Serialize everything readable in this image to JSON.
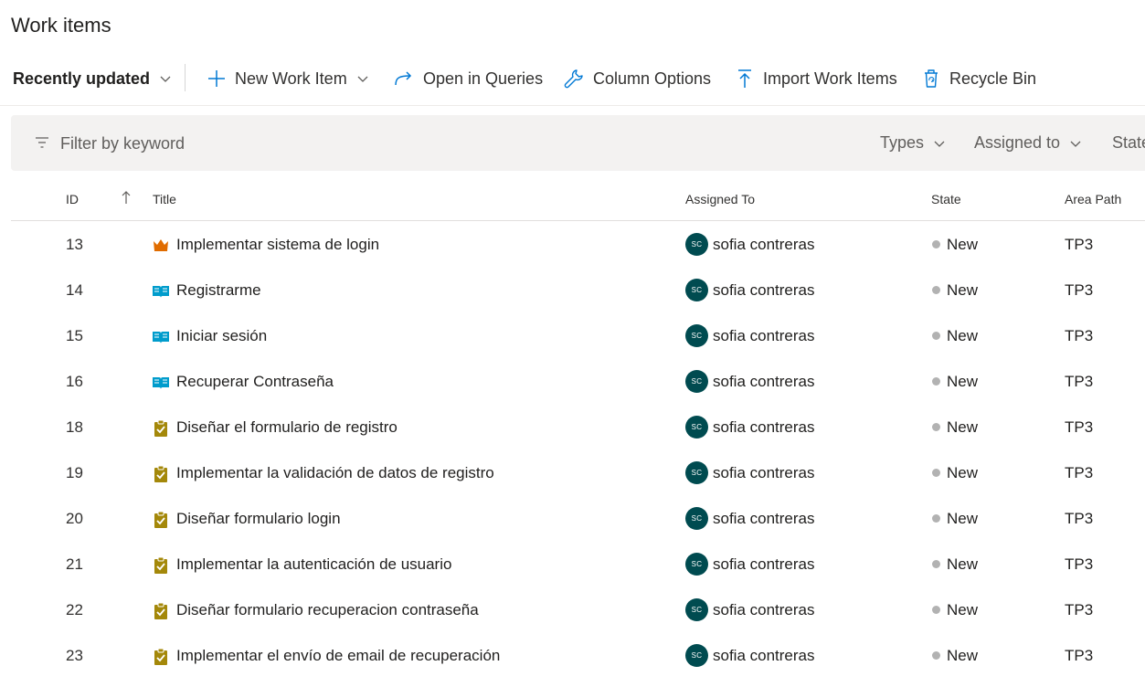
{
  "page": {
    "title": "Work items"
  },
  "toolbar": {
    "view_label": "Recently updated",
    "new_label": "New Work Item",
    "queries_label": "Open in Queries",
    "columns_label": "Column Options",
    "import_label": "Import Work Items",
    "recycle_label": "Recycle Bin"
  },
  "filter": {
    "placeholder": "Filter by keyword",
    "types_label": "Types",
    "assigned_label": "Assigned to",
    "state_label": "State"
  },
  "columns": {
    "id": "ID",
    "title": "Title",
    "assigned_to": "Assigned To",
    "state": "State",
    "area_path": "Area Path"
  },
  "colors": {
    "epic": "#e06c00",
    "user_story": "#009ccc",
    "task": "#a4880a",
    "avatar": "#004b50",
    "state_new": "#b2b2b2"
  },
  "rows": [
    {
      "id": "13",
      "type": "epic-icon",
      "title": "Implementar sistema de login",
      "initials": "SC",
      "assigned": "sofia contreras",
      "state": "New",
      "area": "TP3"
    },
    {
      "id": "14",
      "type": "user-story-icon",
      "title": "Registrarme",
      "initials": "SC",
      "assigned": "sofia contreras",
      "state": "New",
      "area": "TP3"
    },
    {
      "id": "15",
      "type": "user-story-icon",
      "title": "Iniciar sesión",
      "initials": "SC",
      "assigned": "sofia contreras",
      "state": "New",
      "area": "TP3"
    },
    {
      "id": "16",
      "type": "user-story-icon",
      "title": "Recuperar Contraseña",
      "initials": "SC",
      "assigned": "sofia contreras",
      "state": "New",
      "area": "TP3"
    },
    {
      "id": "18",
      "type": "task-icon",
      "title": "Diseñar el formulario de registro",
      "initials": "SC",
      "assigned": "sofia contreras",
      "state": "New",
      "area": "TP3"
    },
    {
      "id": "19",
      "type": "task-icon",
      "title": "Implementar la validación de datos de registro",
      "initials": "SC",
      "assigned": "sofia contreras",
      "state": "New",
      "area": "TP3"
    },
    {
      "id": "20",
      "type": "task-icon",
      "title": "Diseñar formulario login",
      "initials": "SC",
      "assigned": "sofia contreras",
      "state": "New",
      "area": "TP3"
    },
    {
      "id": "21",
      "type": "task-icon",
      "title": "Implementar la autenticación de usuario",
      "initials": "SC",
      "assigned": "sofia contreras",
      "state": "New",
      "area": "TP3"
    },
    {
      "id": "22",
      "type": "task-icon",
      "title": "Diseñar formulario recuperacion contraseña",
      "initials": "SC",
      "assigned": "sofia contreras",
      "state": "New",
      "area": "TP3"
    },
    {
      "id": "23",
      "type": "task-icon",
      "title": "Implementar el envío de email de recuperación",
      "initials": "SC",
      "assigned": "sofia contreras",
      "state": "New",
      "area": "TP3"
    }
  ]
}
